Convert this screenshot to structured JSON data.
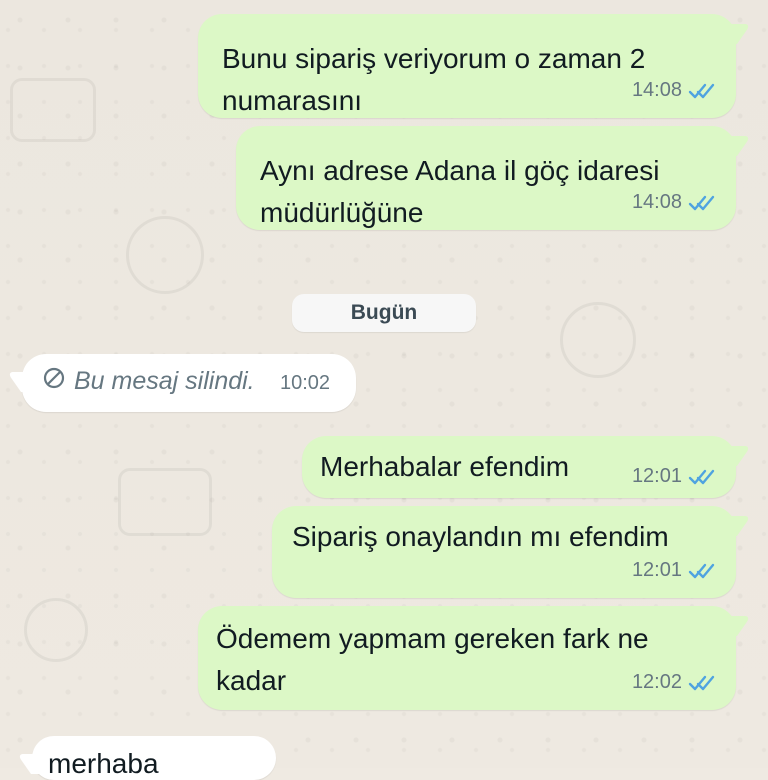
{
  "chat": {
    "messages": [
      {
        "text": "Bunu sipariş veriyorum o zaman 2\nnumarasını",
        "time": "14:08",
        "icon": "double-check-icon"
      },
      {
        "text": "Aynı adrese Adana il göç idaresi\nmüdürlüğüne",
        "time": "14:08",
        "icon": "double-check-icon"
      },
      {
        "text": "Merhabalar efendim",
        "time": "12:01",
        "icon": "double-check-icon"
      },
      {
        "text": "Sipariş onaylandın mı efendim",
        "time": "12:01",
        "icon": "double-check-icon"
      },
      {
        "text": "Ödemem yapmam gereken fark ne\nkadar",
        "time": "12:02",
        "icon": "double-check-icon"
      }
    ],
    "date_divider": "Bugün",
    "deleted_message": {
      "text": "Bu mesaj silindi.",
      "time": "10:02",
      "icon": "blocked-icon"
    },
    "partial_message": {
      "text": "merhaba"
    }
  },
  "colors": {
    "outgoing_bubble": "#dcf8c6",
    "incoming_bubble": "#ffffff",
    "read_tick": "#4fa3e0"
  }
}
